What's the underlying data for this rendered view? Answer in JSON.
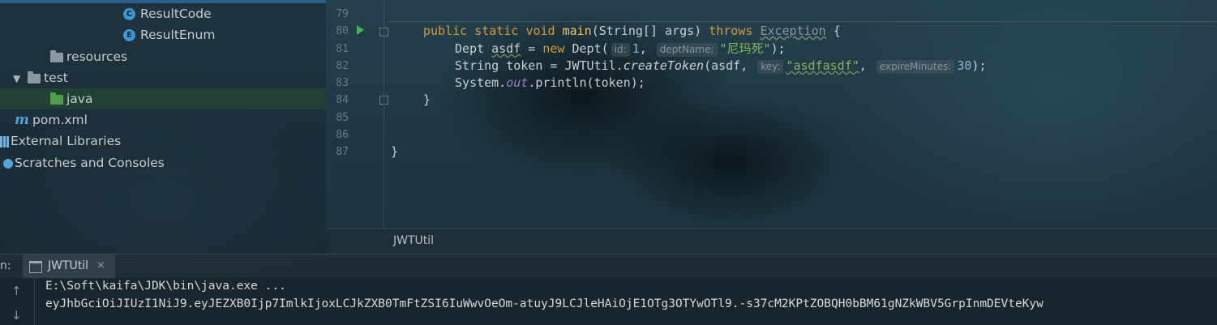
{
  "project_tree": {
    "items": [
      {
        "label": "ResultCode",
        "icon": "class-icon",
        "glyph": "C"
      },
      {
        "label": "ResultEnum",
        "icon": "enum-icon",
        "glyph": "E"
      },
      {
        "label": "resources",
        "icon": "resources-folder-icon"
      },
      {
        "label": "test",
        "icon": "folder-icon"
      },
      {
        "label": "java",
        "icon": "source-folder-icon"
      },
      {
        "label": "pom.xml",
        "icon": "maven-icon",
        "glyph": "m"
      },
      {
        "label": "External Libraries",
        "icon": "libraries-icon"
      },
      {
        "label": "Scratches and Consoles",
        "icon": "scratches-icon"
      }
    ]
  },
  "editor": {
    "line_numbers": [
      "79",
      "80",
      "81",
      "82",
      "83",
      "84",
      "85",
      "86",
      "87"
    ],
    "code": {
      "l80": {
        "public": "public",
        "static": "static",
        "void": "void",
        "main": "main",
        "sig": "(String[] args) ",
        "throws": "throws",
        "exception": "Exception",
        "brace": " {"
      },
      "l81": {
        "type": "Dept ",
        "var": "asdf",
        "assign": " = ",
        "new": "new",
        "ctor": " Dept(",
        "hint_id": "id:",
        "arg1": "1",
        "comma": ", ",
        "hint_name": "deptName:",
        "arg2": "\"尼玛死\"",
        "end": ");"
      },
      "l82": {
        "start": "String token = JWTUtil.",
        "method": "createToken",
        "open": "(asdf, ",
        "hint_key": "key:",
        "arg": "\"asdfasdf\"",
        "comma": ", ",
        "hint_expire": "expireMinutes:",
        "num": "30",
        "end": ");"
      },
      "l83": {
        "start": "System.",
        "field": "out",
        "end": ".println(token);"
      },
      "l84": "}",
      "l87": "}"
    },
    "breadcrumb": "JWTUtil"
  },
  "run_panel": {
    "label": "n:",
    "tab_label": "JWTUtil",
    "tab_close": "×",
    "rerun_arrow": "↑",
    "down_arrow": "↓",
    "output_lines": [
      "E:\\Soft\\kaifa\\JDK\\bin\\java.exe ...",
      "eyJhbGciOiJIUzI1NiJ9.eyJEZXB0Ijp7ImlkIjoxLCJkZXB0TmFtZSI6IuWwvOeOm-atuyJ9LCJleHAiOjE1OTg3OTYwOTl9.-s37cM2KPtZOBQH0bBM61gNZkWBV5GrpInmDEVteKyw"
    ]
  }
}
